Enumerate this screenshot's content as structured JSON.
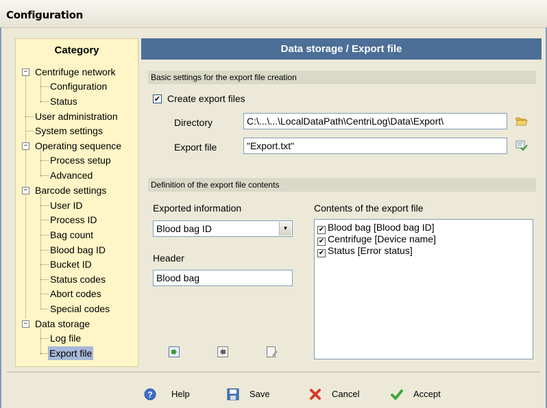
{
  "window": {
    "title": "Configuration"
  },
  "category": {
    "title": "Category",
    "items": [
      {
        "label": "Centrifuge network",
        "level": 0
      },
      {
        "label": "Configuration",
        "level": 1
      },
      {
        "label": "Status",
        "level": 1
      },
      {
        "label": "User administration",
        "level": 0
      },
      {
        "label": "System settings",
        "level": 0
      },
      {
        "label": "Operating sequence",
        "level": 0
      },
      {
        "label": "Process setup",
        "level": 1
      },
      {
        "label": "Advanced",
        "level": 1
      },
      {
        "label": "Barcode settings",
        "level": 0
      },
      {
        "label": "User ID",
        "level": 1
      },
      {
        "label": "Process ID",
        "level": 1
      },
      {
        "label": "Bag count",
        "level": 1
      },
      {
        "label": "Blood bag ID",
        "level": 1
      },
      {
        "label": "Bucket ID",
        "level": 1
      },
      {
        "label": "Status codes",
        "level": 1
      },
      {
        "label": "Abort codes",
        "level": 1
      },
      {
        "label": "Special codes",
        "level": 1
      },
      {
        "label": "Data storage",
        "level": 0
      },
      {
        "label": "Log file",
        "level": 1
      },
      {
        "label": "Export file",
        "level": 1,
        "selected": true
      }
    ]
  },
  "panel": {
    "title": "Data storage / Export file",
    "basic_section": "Basic settings for the export file creation",
    "create_export_label": "Create export files",
    "create_export_checked": "✔",
    "directory_label": "Directory",
    "directory_value": "C:\\...\\...\\LocalDataPath\\CentriLog\\Data\\Export\\",
    "export_file_label": "Export file",
    "export_file_value": "\"Export.txt\"",
    "definition_section": "Definition of the export file contents",
    "exported_info_label": "Exported information",
    "exported_info_value": "Blood bag ID",
    "header_label": "Header",
    "header_value": "Blood bag",
    "contents_label": "Contents of the export file",
    "contents_items": [
      {
        "label": "Blood bag [Blood bag ID]",
        "checked": "✔"
      },
      {
        "label": "Centrifuge [Device name]",
        "checked": "✔"
      },
      {
        "label": "Status [Error status]",
        "checked": "✔"
      }
    ]
  },
  "footer": {
    "help_label": "Help",
    "save_label": "Save",
    "cancel_label": "Cancel",
    "accept_label": "Accept"
  },
  "colors": {
    "category_bg": "#fff5c6",
    "panel_header_bg": "#4d6f97",
    "section_bar_bg": "#d9d9c8"
  }
}
